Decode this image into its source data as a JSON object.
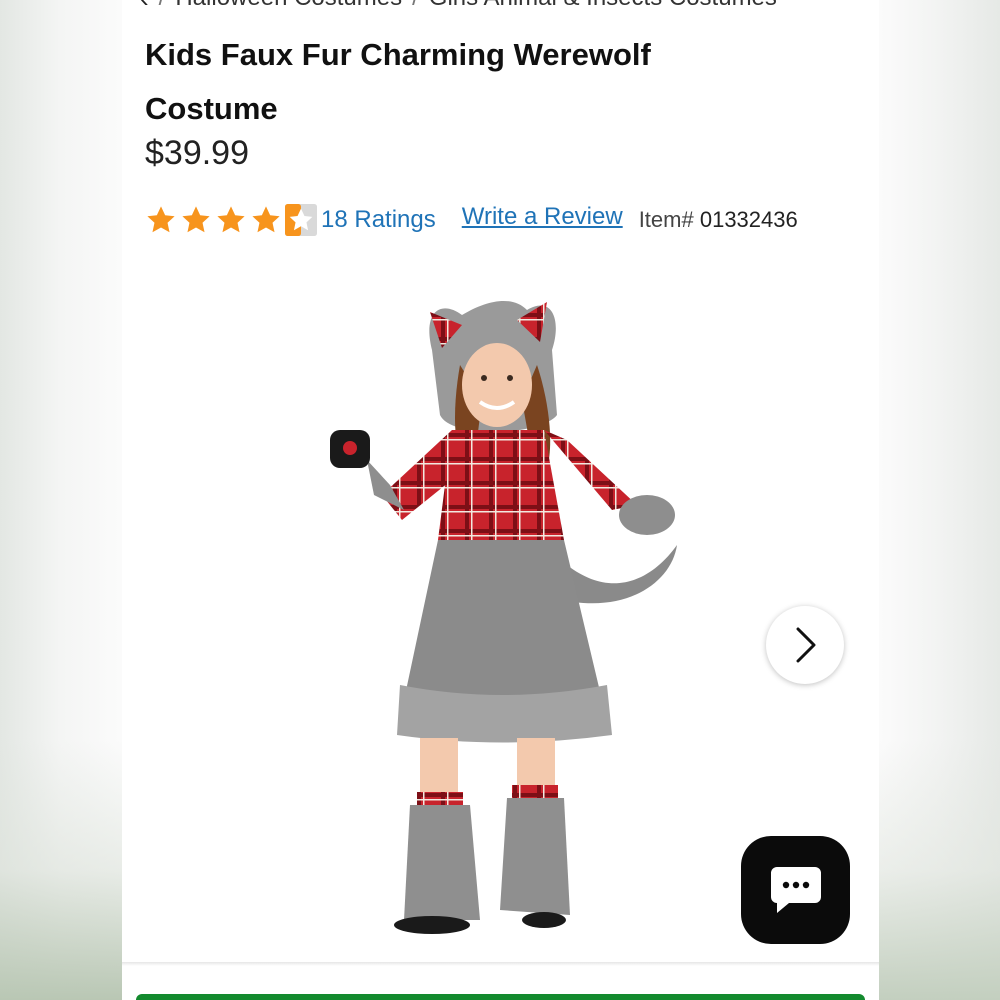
{
  "breadcrumb": {
    "back_icon": "chevron-left-icon",
    "items": [
      "Halloween Costumes",
      "Girls Animal & Insects Costumes"
    ],
    "separator": "/"
  },
  "product": {
    "title": "Kids Faux Fur Charming Werewolf Costume",
    "price": "$39.99",
    "rating_value": 4.5,
    "rating_max": 5,
    "ratings_text": "18 Ratings",
    "write_review": "Write a Review",
    "item_label": "Item#",
    "item_number": "01332436"
  },
  "gallery": {
    "next_icon": "chevron-right-icon"
  },
  "chat": {
    "icon": "chat-bubble-icon"
  },
  "colors": {
    "star": "#f7941d",
    "link": "#1f73b7",
    "cta": "#138a2e",
    "chat_bg": "#0b0b0b"
  }
}
